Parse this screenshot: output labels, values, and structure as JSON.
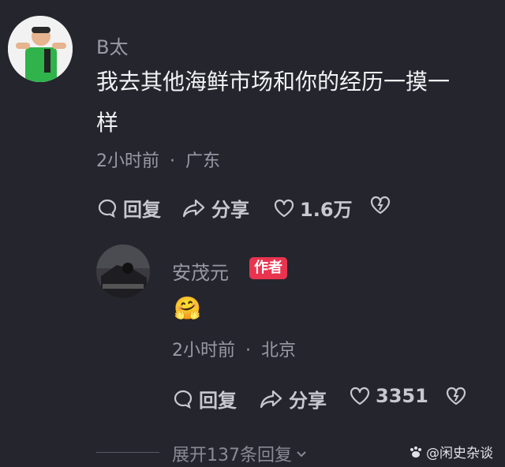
{
  "comment": {
    "username": "B太",
    "text_line1": "我去其他海鲜市场和你的经历一摸一",
    "text_line2": "样",
    "time": "2小时前",
    "location": "广东",
    "reply_label": "回复",
    "share_label": "分享",
    "like_count": "1.6万"
  },
  "reply": {
    "username": "安茂元",
    "author_badge": "作者",
    "emoji": "🤗",
    "time": "2小时前",
    "location": "北京",
    "reply_label": "回复",
    "share_label": "分享",
    "like_count": "3351"
  },
  "expand_label": "展开137条回复",
  "watermark": "@闲史杂谈",
  "separator": "·",
  "colors": {
    "background": "#25252e",
    "badge": "#e8344f",
    "muted": "#9a9aa6"
  }
}
